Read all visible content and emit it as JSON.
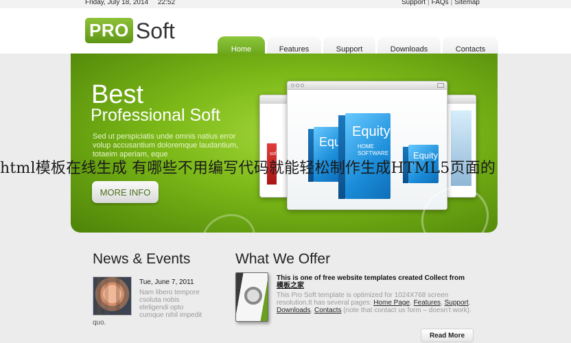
{
  "topbar": {
    "date": "Friday, July 18, 2014",
    "time": "22:52",
    "links": [
      "Support",
      "FAQs",
      "Sitemap"
    ],
    "separator": "|"
  },
  "logo": {
    "pro": "PRO",
    "soft": "Soft"
  },
  "nav": {
    "tabs": [
      "Home",
      "Features",
      "Support",
      "Downloads",
      "Contacts"
    ],
    "active": "Home"
  },
  "banner": {
    "title_line1": "Best",
    "title_line2": "Professional Soft",
    "description": "Sed ut perspiciatis unde omnis natius error volup accusantium doloremque laudantium, totaeim aperiam, eque",
    "button": "MORE INFO",
    "product": {
      "brand": "Equity",
      "line1": "HOME",
      "line2": "SOFTWARE",
      "red_label": "sof"
    }
  },
  "overlay_caption": "html模板在线生成 有哪些不用编写代码就能轻松制作生成HTML5页面的",
  "news": {
    "title": "News & Events",
    "date": "Tue, June 7, 2011",
    "text": "Nam libero tempore csoluta nobis eleligendi opto cumque nihil impedit",
    "tail": "quo."
  },
  "offer": {
    "title": "What We Offer",
    "headline": "This is one of free website templates created Collect from",
    "headline_link": "模板之家",
    "text_intro": "This Pro Soft template is optimized for 1024X768 screen resolution.It has several pages:",
    "links": [
      "Home Page",
      "Features",
      "Support",
      "Downloads",
      "Contacts"
    ],
    "text_outro": "(note that contact us form – doesn't work).",
    "button": "Read More"
  },
  "colors": {
    "accent_green": "#7ab717",
    "nav_active": "#6fae20",
    "product_blue": "#1b8dd9"
  }
}
